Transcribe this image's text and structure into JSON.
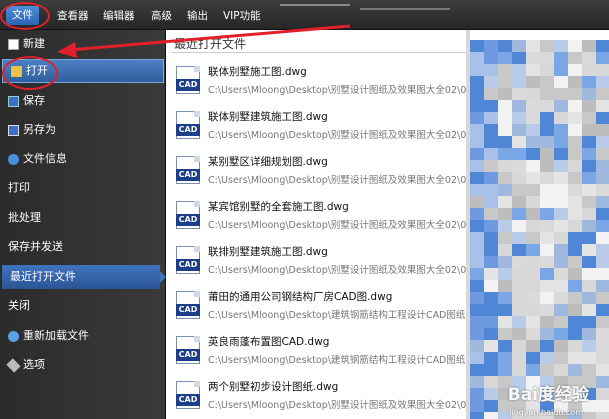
{
  "menubar": {
    "items": [
      "文件",
      "查看器",
      "编辑器",
      "高级",
      "输出",
      "VIP功能"
    ]
  },
  "sidebar": {
    "items": [
      {
        "label": "新建",
        "icon": "new-file-icon"
      },
      {
        "label": "打开",
        "icon": "folder-open-icon"
      },
      {
        "label": "保存",
        "icon": "save-icon"
      },
      {
        "label": "另存为",
        "icon": "save-as-icon"
      },
      {
        "label": "文件信息",
        "icon": "info-icon"
      },
      {
        "label": "打印",
        "icon": ""
      },
      {
        "label": "批处理",
        "icon": ""
      },
      {
        "label": "保存并发送",
        "icon": ""
      },
      {
        "label": "最近打开文件",
        "icon": ""
      },
      {
        "label": "关闭",
        "icon": ""
      },
      {
        "label": "重新加载文件",
        "icon": "reload-icon"
      },
      {
        "label": "选项",
        "icon": "options-icon"
      }
    ]
  },
  "main": {
    "title": "最近打开文件",
    "icon_label": "CAD",
    "files": [
      {
        "name": "联体别墅施工图.dwg",
        "path": "C:\\Users\\Mloong\\Desktop\\别墅设计图纸及效果图大全02\\01"
      },
      {
        "name": "联体别墅建筑施工图.dwg",
        "path": "C:\\Users\\Mloong\\Desktop\\别墅设计图纸及效果图大全02\\01"
      },
      {
        "name": "某别墅区详细规划图.dwg",
        "path": "C:\\Users\\Mloong\\Desktop\\别墅设计图纸及效果图大全02\\01"
      },
      {
        "name": "某宾馆别墅的全套施工图.dwg",
        "path": "C:\\Users\\Mloong\\Desktop\\别墅设计图纸及效果图大全02\\01"
      },
      {
        "name": "联排别墅建筑施工图.dwg",
        "path": "C:\\Users\\Mloong\\Desktop\\别墅设计图纸及效果图大全02\\01"
      },
      {
        "name": "莆田的通用公司钢结构厂房CAD图.dwg",
        "path": "C:\\Users\\Mloong\\Desktop\\建筑钢筋结构工程设计CAD图纸及"
      },
      {
        "name": "英良雨蓬布置图CAD.dwg",
        "path": "C:\\Users\\Mloong\\Desktop\\建筑钢筋结构工程设计CAD图纸及"
      },
      {
        "name": "两个别墅初步设计图纸.dwg",
        "path": "C:\\Users\\Mloong\\Desktop\\别墅设计图纸及效果图大全02\\01"
      }
    ]
  },
  "watermark": {
    "text": "Bai度经验",
    "sub": "jingyan.baidu.com"
  },
  "colors": {
    "annotation": "#e0202a",
    "active_tab": "#2a63b3",
    "cad_band": "#1d3f8a"
  }
}
